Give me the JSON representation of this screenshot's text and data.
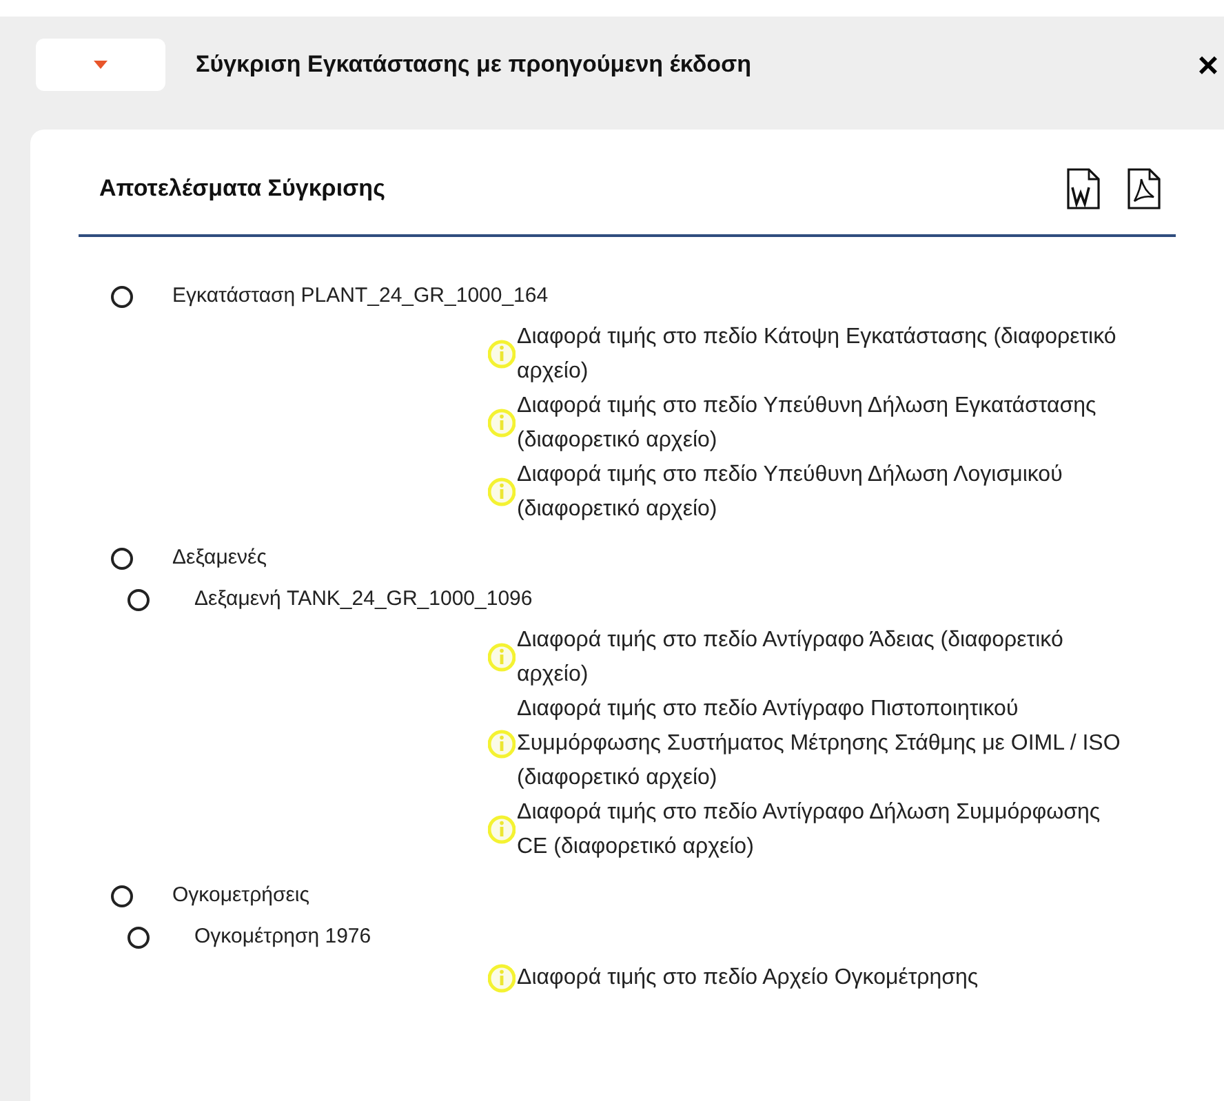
{
  "dialog": {
    "title": "Σύγκριση Εγκατάστασης με προηγούμενη έκδοση",
    "close": "×"
  },
  "results": {
    "title": "Αποτελέσματα Σύγκρισης",
    "tree": [
      {
        "label": "Εγκατάσταση PLANT_24_GR_1000_164",
        "messages": [
          "Διαφορά τιμής στο πεδίο Κάτοψη Εγκατάστασης (διαφορετικό αρχείο)",
          "Διαφορά τιμής στο πεδίο Υπεύθυνη Δήλωση Εγκατάστασης (διαφορετικό αρχείο)",
          "Διαφορά τιμής στο πεδίο Υπεύθυνη Δήλωση Λογισμικού (διαφορετικό αρχείο)"
        ]
      },
      {
        "label": "Δεξαμενές",
        "children": [
          {
            "label": "Δεξαμενή TANK_24_GR_1000_1096",
            "messages": [
              "Διαφορά τιμής στο πεδίο Αντίγραφο Άδειας (διαφορετικό αρχείο)",
              "Διαφορά τιμής στο πεδίο Αντίγραφο Πιστοποιητικού Συμμόρφωσης Συστήματος Μέτρησης Στάθμης με OIML / ISO (διαφορετικό αρχείο)",
              "Διαφορά τιμής στο πεδίο Αντίγραφο Δήλωση Συμμόρφωσης CE (διαφορετικό αρχείο)"
            ]
          }
        ]
      },
      {
        "label": "Ογκομετρήσεις",
        "children": [
          {
            "label": "Ογκομέτρηση 1976",
            "messages": [
              "Διαφορά τιμής στο πεδίο Αρχείο Ογκομέτρησης"
            ]
          }
        ]
      }
    ]
  }
}
